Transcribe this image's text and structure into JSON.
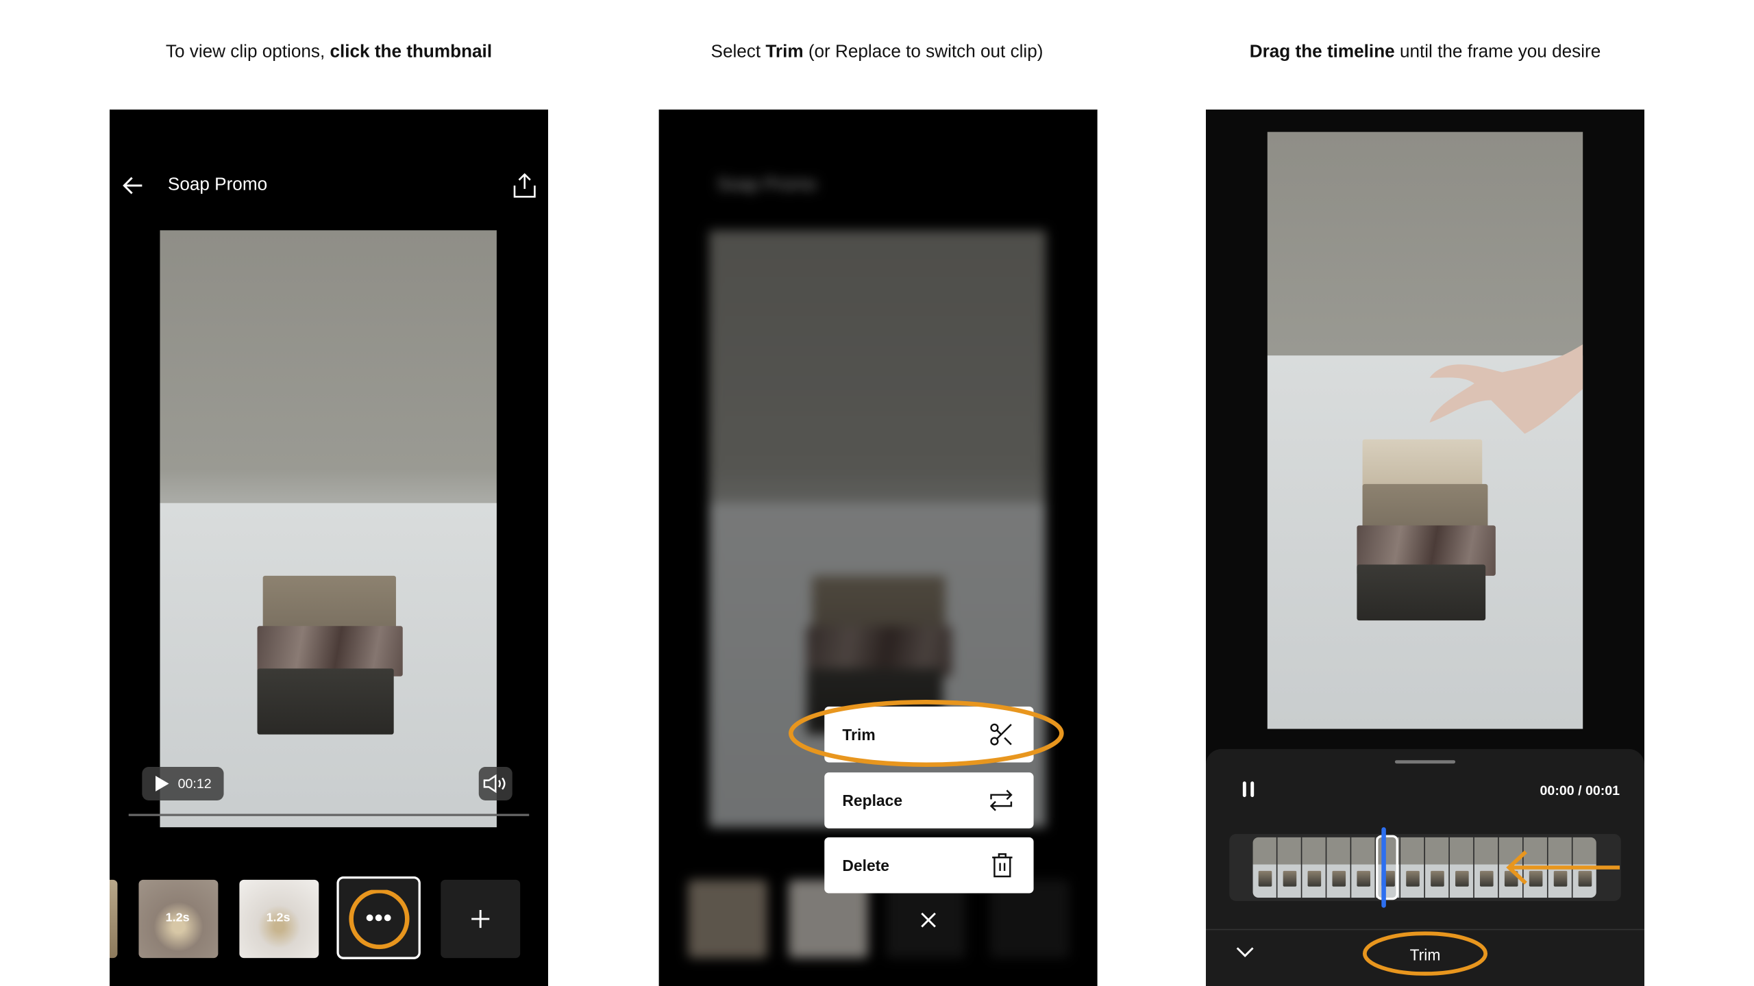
{
  "captions": [
    {
      "pre": "To view clip options, ",
      "bold": "click the thumbnail",
      "post": ""
    },
    {
      "pre": "Select ",
      "bold": "Trim",
      "post": " (or Replace to switch out clip)"
    },
    {
      "pre": "",
      "bold": "Drag the timeline",
      "post": " until the frame you desire"
    }
  ],
  "editor": {
    "title": "Soap Promo",
    "duration": "00:12",
    "clips": [
      {
        "label": "1.2s"
      },
      {
        "label": "1.2s"
      }
    ],
    "icons": [
      "back-arrow-icon",
      "share-icon",
      "play-icon",
      "volume-icon",
      "more-icon",
      "plus-icon"
    ]
  },
  "clip_menu": {
    "items": [
      {
        "label": "Trim",
        "icon": "scissors-icon"
      },
      {
        "label": "Replace",
        "icon": "swap-icon"
      },
      {
        "label": "Delete",
        "icon": "trash-icon"
      }
    ],
    "close_icon": "close-icon"
  },
  "trim_sheet": {
    "time": "00:00 / 00:01",
    "title": "Trim",
    "frame_count": 14,
    "playhead_frame": 6,
    "icons": [
      "pause-icon",
      "chevron-down-icon"
    ]
  },
  "colors": {
    "highlight": "#e8961e",
    "playhead": "#2d6ff0",
    "sheet": "#1c1c1c"
  }
}
